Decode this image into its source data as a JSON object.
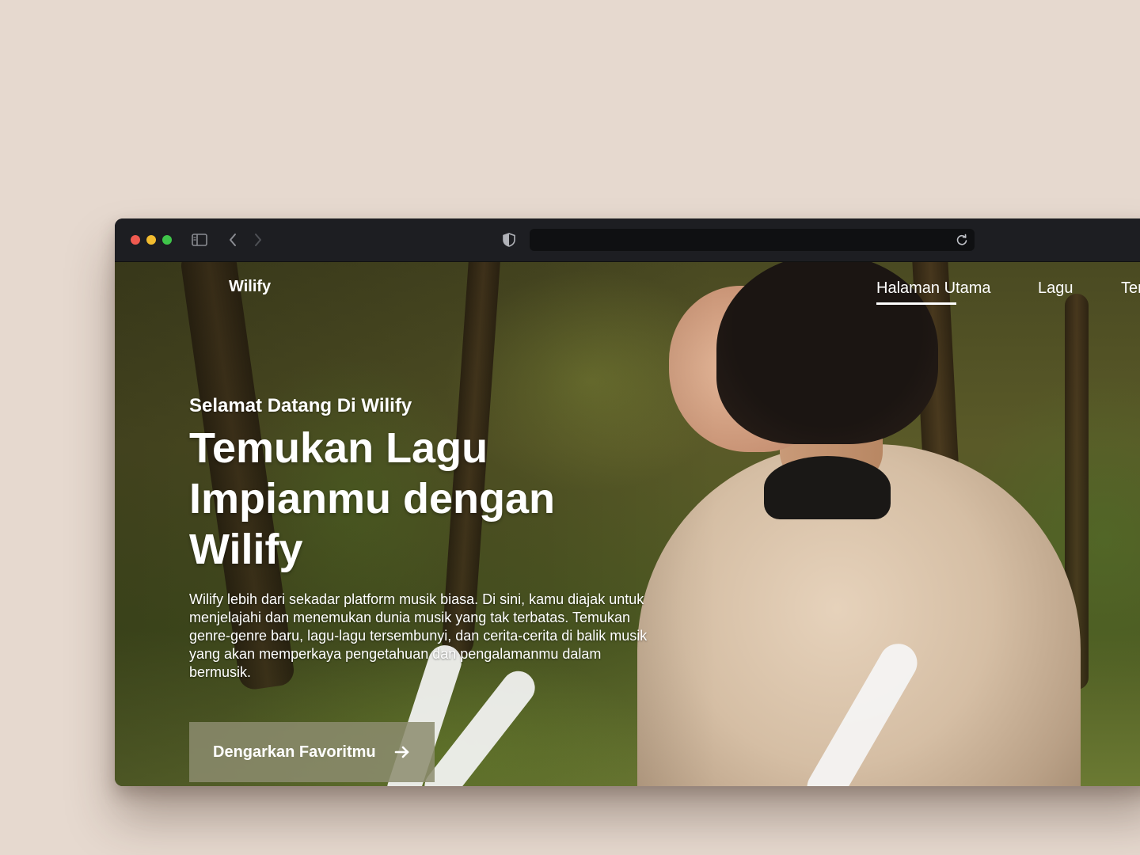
{
  "browser": {
    "address": "",
    "icons": [
      "sidebar-toggle-icon",
      "chevron-left-icon",
      "chevron-right-icon",
      "shield-icon",
      "reload-icon"
    ]
  },
  "site": {
    "brand": "Wilify",
    "nav": [
      {
        "label": "Halaman Utama",
        "active": true
      },
      {
        "label": "Lagu",
        "active": false
      },
      {
        "label": "Ter",
        "active": false
      }
    ]
  },
  "hero": {
    "welcome": "Selamat Datang Di Wilify",
    "headline": "Temukan Lagu Impianmu dengan Wilify",
    "description": "Wilify lebih dari sekadar platform musik biasa. Di sini, kamu diajak untuk menjelajahi dan menemukan dunia musik yang tak terbatas. Temukan genre-genre baru, lagu-lagu tersembunyi, dan cerita-cerita di balik musik yang akan memperkaya pengetahuan dan pengalamanmu dalam bermusik.",
    "cta_label": "Dengarkan Favoritmu",
    "cta_icon": "arrow-right-icon"
  },
  "colors": {
    "page_background": "#e6d9cf",
    "titlebar": "#1d1e22",
    "cta_background": "#8c8c6e"
  }
}
